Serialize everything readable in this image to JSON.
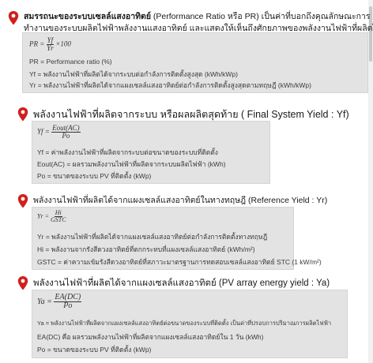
{
  "sections": [
    {
      "title_thai": "สมรรถนะของระบบเซลล์แสงอาทิตย์",
      "title_rest": " (Performance Ratio หรือ PR) เป็นค่าที่บอกถึงคุณลักษณะการ",
      "title_line2": "ทำงานของระบบผลิตไฟฟ้าพลังงานแสงอาทิตย์ และแสดงให้เห็นถึงศักยภาพของพลังงานไฟฟ้าที่ผลิตได้",
      "formula": {
        "lhs": "PR =",
        "num": "Yf",
        "den": "Yr",
        "tail": "×100"
      },
      "lines": [
        "PR = Performance ratio (%)",
        "Yf = พลังงานไฟฟ้าที่ผลิตได้จากระบบต่อกำลังการติดตั้งสูงสุด  (kWh/kWp)",
        "Yr = พลังงานไฟฟ้าที่ผลิตได้จากแผงเซลล์แสงอาทิตย์ต่อกำลังการติดตั้งสูงสุดตามทฤษฎี  (kWh/kWp)"
      ]
    },
    {
      "title": "พลังงานไฟฟ้าที่ผลิตจากระบบ หรือผลผลิตสุดท้าย ( Final System Yield : Yf)",
      "formula": {
        "lhs": "Yf =",
        "num": "Eout(AC)",
        "den": "Po"
      },
      "lines": [
        "Yf = ค่าพลังงานไฟฟ้าที่ผลิตจากระบบต่อขนาดของระบบที่ติดตั้ง",
        "Eout(AC) = ผลรวมพลังงานไฟฟ้าที่ผลิตจากระบบผลิตไฟฟ้า  (kWh)",
        "Po = ขนาดของระบบ PV ที่ติดตั้ง (kWp)"
      ]
    },
    {
      "title": "พลังงานไฟฟ้าที่ผลิตได้จากแผงเซลล์แสงอาทิตย์ในทางทฤษฎี (Reference Yield : Yr)",
      "formula": {
        "lhs": "Yr =",
        "num": "Hi",
        "den": "GSTC"
      },
      "lines": [
        "Yr = พลังงานไฟฟ้าที่ผลิตได้จากแผงเซลล์แสงอาทิตย์ต่อกำลังการติดตั้งทางทฤษฎี",
        "Hi = พลังงานจากรังสีดวงอาทิตย์ที่ตกกระทบที่แผงเซลล์แสงอาทิตย์  (kWh/m²)",
        "GSTC = ค่าความเข้มรังสีดวงอาทิตย์ที่สภาวะมาตรฐานการทดสอบเซลล์แสงอาทิตย์  STC (1 kW/m²)"
      ]
    },
    {
      "title": "พลังงานไฟฟ้าที่ผลิตได้จากแผงเซลล์แสงอาทิตย์ (PV array energy yield : Ya)",
      "formula": {
        "lhs": "Ya =",
        "num": "EA(DC)",
        "den": "Po"
      },
      "lines": [
        "Ya = พลังงานไฟฟ้าที่ผลิตจากแผงเซลล์แสงอาทิตย์ต่อขนาดของระบบที่ติดตั้ง เป็นค่าที่ปรอบการปริมาณการผลิตไฟฟ้า",
        "EA(DC) คือ ผลรวมพลังงานไฟฟ้าที่ผลิตจากแผงเซลล์แสงอาทิตย์ใน 1 วัน (kWh)",
        "Po = ขนาดของระบบ PV ที่ติดตั้ง (kWp)"
      ]
    }
  ],
  "colors": {
    "pin": "#d0201c",
    "box": "#e3e3e3"
  },
  "icons": {
    "pin": "map-pin-icon"
  }
}
